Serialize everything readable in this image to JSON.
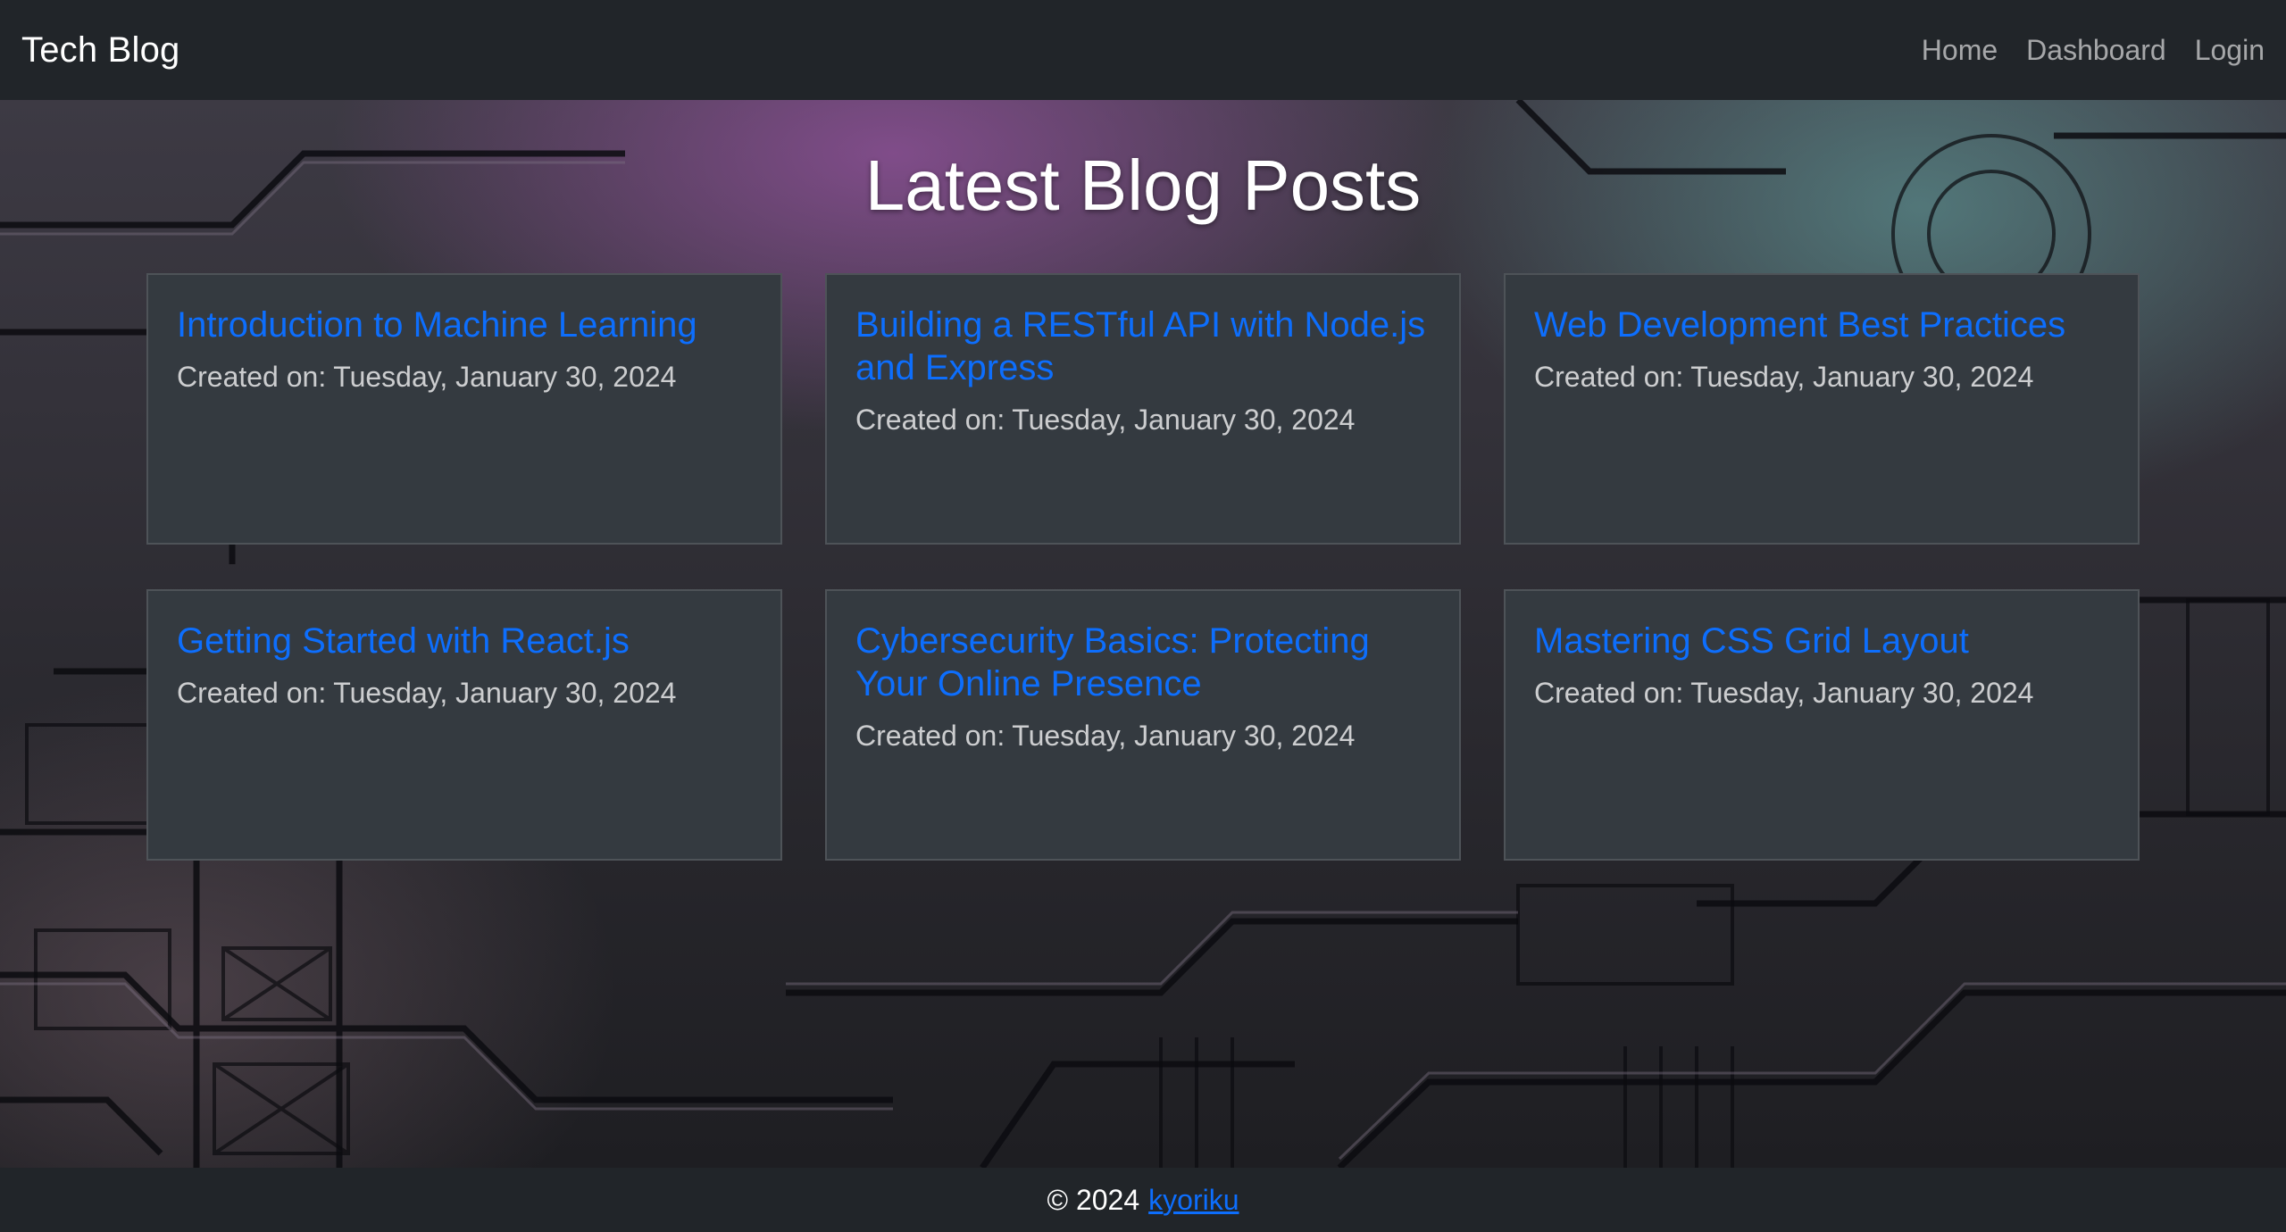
{
  "navbar": {
    "brand": "Tech Blog",
    "links": [
      "Home",
      "Dashboard",
      "Login"
    ]
  },
  "hero": {
    "title": "Latest Blog Posts"
  },
  "posts": [
    {
      "title": "Introduction to Machine Learning",
      "date_prefix": "Created on:",
      "date": "Tuesday, January 30, 2024"
    },
    {
      "title": "Building a RESTful API with Node.js and Express",
      "date_prefix": "Created on:",
      "date": "Tuesday, January 30, 2024"
    },
    {
      "title": "Web Development Best Practices",
      "date_prefix": "Created on:",
      "date": "Tuesday, January 30, 2024"
    },
    {
      "title": "Getting Started with React.js",
      "date_prefix": "Created on:",
      "date": "Tuesday, January 30, 2024"
    },
    {
      "title": "Cybersecurity Basics: Protecting Your Online Presence",
      "date_prefix": "Created on:",
      "date": "Tuesday, January 30, 2024"
    },
    {
      "title": "Mastering CSS Grid Layout",
      "date_prefix": "Created on:",
      "date": "Tuesday, January 30, 2024"
    }
  ],
  "footer": {
    "copyright": "© 2024",
    "author": "kyoriku"
  },
  "colors": {
    "navbar_bg": "#212529",
    "card_bg": "#343a40",
    "link": "#0d6efd",
    "text": "#ffffff"
  }
}
